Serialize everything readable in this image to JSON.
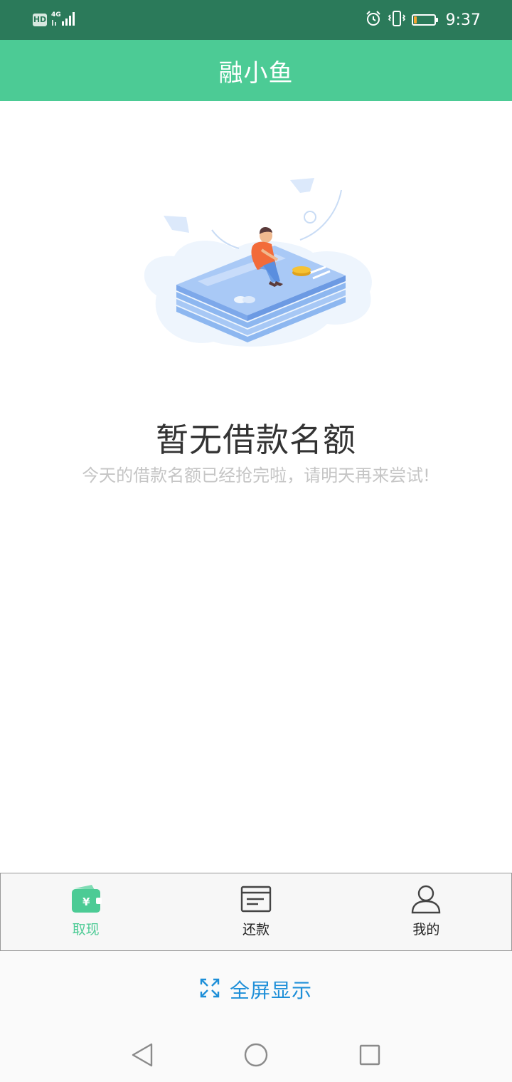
{
  "status_bar": {
    "network_badge": "HD",
    "network_type": "4G",
    "time": "9:37",
    "battery_level_percent": 15,
    "battery_color": "#f6a531",
    "icons": [
      "hd-icon",
      "signal-icon",
      "alarm-icon",
      "vibrate-icon",
      "battery-icon"
    ]
  },
  "header": {
    "title": "融小鱼",
    "background_color": "#4ccb95"
  },
  "empty_state": {
    "illustration": "person-sitting-on-card-stack-illustration",
    "title": "暂无借款名额",
    "subtitle": "今天的借款名额已经抢完啦，请明天再来尝试!"
  },
  "tab_bar": {
    "tabs": [
      {
        "label": "取现",
        "icon": "wallet-icon",
        "active": true
      },
      {
        "label": "还款",
        "icon": "bill-icon",
        "active": false
      },
      {
        "label": "我的",
        "icon": "user-icon",
        "active": false
      }
    ],
    "active_color": "#4ccb95"
  },
  "fullscreen": {
    "label": "全屏显示",
    "icon": "expand-icon",
    "color": "#1e8fd8"
  },
  "nav_bar": {
    "buttons": [
      "back-icon",
      "home-icon",
      "recents-icon"
    ]
  }
}
